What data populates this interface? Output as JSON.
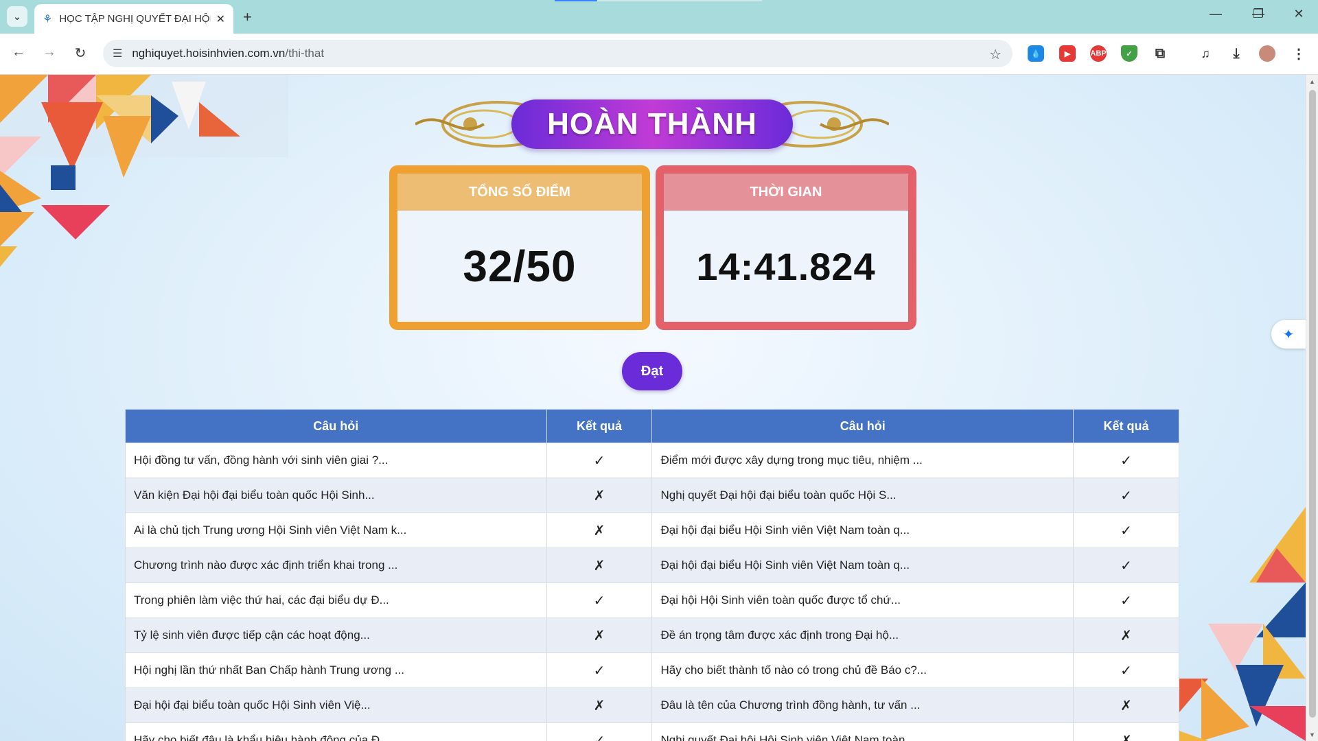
{
  "browser": {
    "tab_title": "HỌC TẬP NGHỊ QUYẾT ĐẠI HỘI",
    "url_host": "nghiquyet.hoisinhvien.com.vn",
    "url_path": "/thi-that"
  },
  "page": {
    "title": "HOÀN THÀNH",
    "score_label": "TỔNG SỐ ĐIỂM",
    "score_value": "32/50",
    "time_label": "THỜI GIAN",
    "time_value": "14:41.824",
    "status_button": "Đạt"
  },
  "table": {
    "headers": [
      "Câu hỏi",
      "Kết quả",
      "Câu hỏi",
      "Kết quả"
    ],
    "rows": [
      {
        "q1": "Hội đồng tư vấn, đồng hành với sinh viên giai ?...",
        "r1": "✓",
        "q2": "Điểm mới được xây dựng trong mục tiêu, nhiệm ...",
        "r2": "✓"
      },
      {
        "q1": "Văn kiện Đại hội đại biểu toàn quốc Hội Sinh...",
        "r1": "✗",
        "q2": "Nghị quyết Đại hội đại biểu toàn quốc Hội S...",
        "r2": "✓"
      },
      {
        "q1": "Ai là chủ tịch Trung ương Hội Sinh viên Việt Nam k...",
        "r1": "✗",
        "q2": "Đại hội đại biểu Hội Sinh viên Việt Nam toàn q...",
        "r2": "✓"
      },
      {
        "q1": "Chương trình nào được xác định triển khai trong ...",
        "r1": "✗",
        "q2": "Đại hội đại biểu Hội Sinh viên Việt Nam toàn q...",
        "r2": "✓"
      },
      {
        "q1": "Trong phiên làm việc thứ hai, các đại biểu dự Đ...",
        "r1": "✓",
        "q2": "Đại hội Hội Sinh viên toàn quốc được tổ chứ...",
        "r2": "✓"
      },
      {
        "q1": "Tỷ lệ sinh viên được tiếp cận các hoạt động...",
        "r1": "✗",
        "q2": "Đề án trọng tâm được xác định trong Đại hộ...",
        "r2": "✗"
      },
      {
        "q1": "Hội nghị lần thứ nhất Ban Chấp hành Trung ương ...",
        "r1": "✓",
        "q2": "Hãy cho biết thành tố nào có trong chủ đề Báo c?...",
        "r2": "✓"
      },
      {
        "q1": "Đại hội đại biểu toàn quốc Hội Sinh viên Việ...",
        "r1": "✗",
        "q2": "Đâu là tên của Chương trình đồng hành, tư vấn ...",
        "r2": "✗"
      },
      {
        "q1": "Hãy cho biết đâu là khẩu hiệu hành động của Đ...",
        "r1": "✓",
        "q2": "Nghị quyết Đại hội Hội Sinh viên Việt Nam toàn...",
        "r2": "✗"
      }
    ]
  },
  "extensions": [
    "water-drop",
    "video-speed",
    "adblock-plus",
    "shield",
    "puzzle"
  ]
}
